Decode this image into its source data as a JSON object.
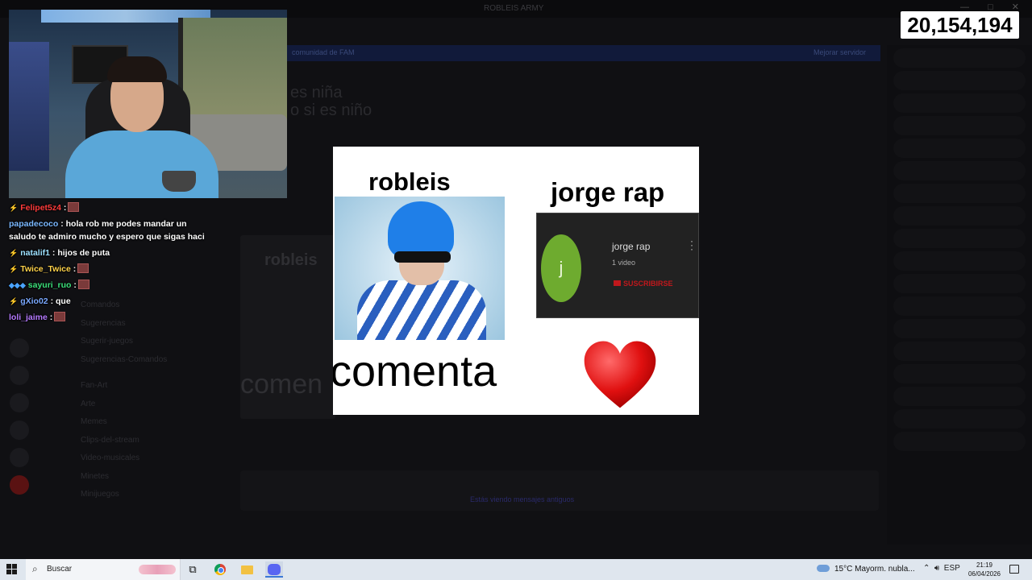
{
  "background_app": {
    "window_title": "ROBLEIS ARMY",
    "banner_left": "comunidad de FAM",
    "banner_right": "Mejorar servidor",
    "message_lines": [
      "es niña",
      "o si es niño"
    ],
    "channels": [
      "Comandos",
      "Sugerencias",
      "Sugerir-juegos",
      "Sugerencias-Comandos",
      "Fan-Art",
      "Arte",
      "Memes",
      "Clips-del-stream",
      "Video-musicales",
      "Minetes",
      "Minijuegos"
    ],
    "embedded_preview": {
      "name": "robleis",
      "word": "comen"
    },
    "compose_hint": "Estás viendo mensajes antiguos"
  },
  "counter": "20,154,194",
  "chat": [
    {
      "badges": "⚡",
      "user": "Felipet5z4",
      "user_color": "#ff3b3b",
      "text": ":",
      "emote": true
    },
    {
      "badges": "",
      "user": "papadecoco",
      "user_color": "#7ab8ff",
      "text": ": hola rob me podes mandar un saludo te admiro mucho y espero que sigas haci",
      "emote": false
    },
    {
      "badges": "⚡",
      "user": "natalif1",
      "user_color": "#9de0ff",
      "text": ": hijos de puta",
      "emote": false
    },
    {
      "badges": "⚡",
      "user": "Twice_Twice",
      "user_color": "#ffd24a",
      "text": ":",
      "emote": true
    },
    {
      "badges": "◆◆◆",
      "user": "sayuri_ruo",
      "user_color": "#3be07a",
      "text": ":",
      "emote": true
    },
    {
      "badges": "⚡",
      "user": "gXio02",
      "user_color": "#7aa8ff",
      "text": ": que",
      "emote": false
    },
    {
      "badges": "",
      "user": "loli_jaime",
      "user_color": "#b57aff",
      "text": ":",
      "emote": true
    }
  ],
  "meme": {
    "left_title": "robleis",
    "right_title": "jorge rap",
    "card": {
      "avatar_letter": "j",
      "channel_name": "jorge rap",
      "videos": "1 video",
      "subscribe": "SUSCRIBIRSE"
    },
    "bottom_text": "comenta",
    "heart_color": "#e01010"
  },
  "taskbar": {
    "search_label": "Buscar",
    "weather": "15°C  Mayorm. nubla...",
    "language": "ESP",
    "time": "21:19",
    "date": "06/04/2026"
  }
}
